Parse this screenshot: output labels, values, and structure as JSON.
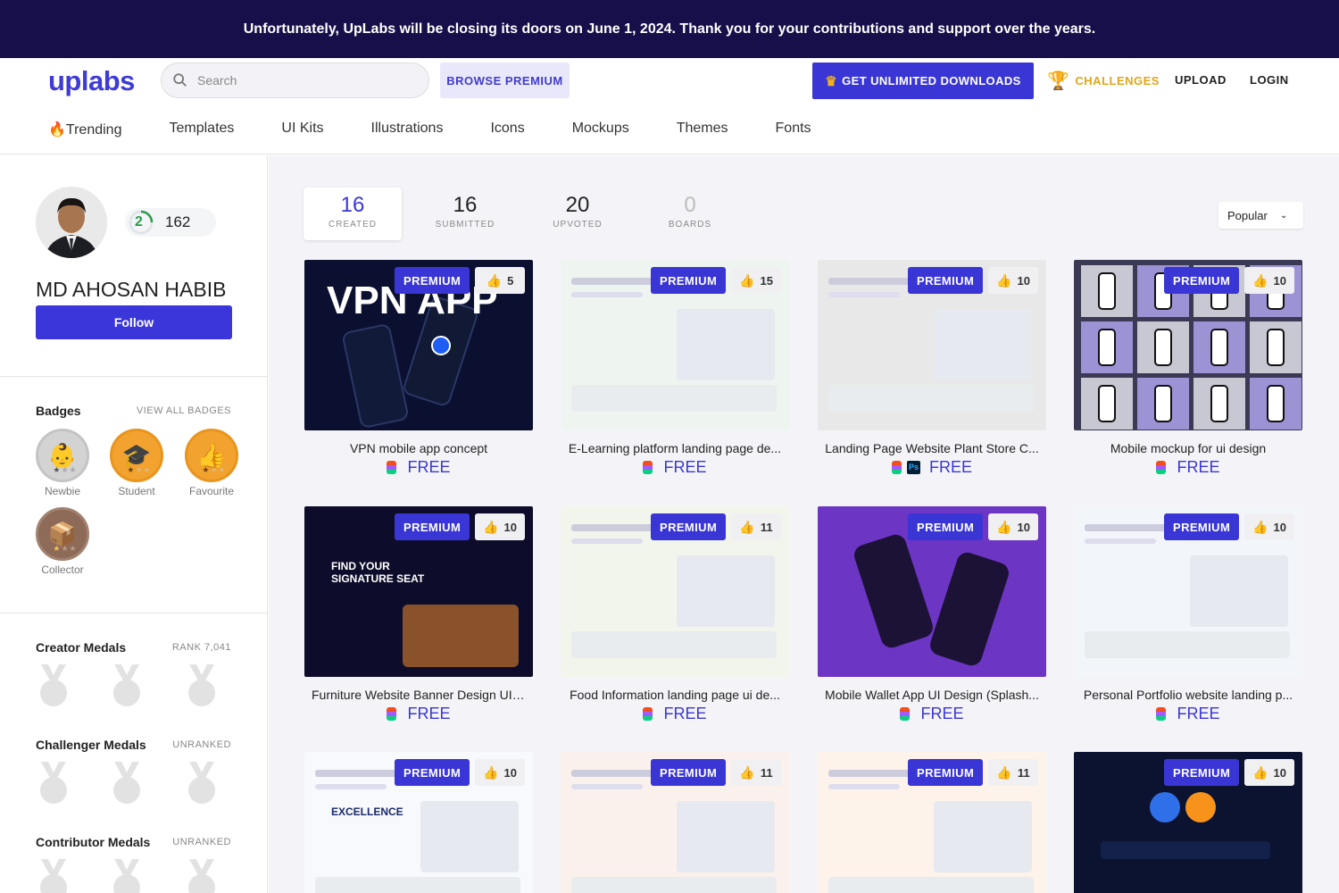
{
  "banner": {
    "text": "Unfortunately, UpLabs will be closing its doors on June 1, 2024. Thank you for your contributions and support over the years."
  },
  "header": {
    "logo": "uplabs",
    "search_placeholder": "Search",
    "browse_premium": "BROWSE PREMIUM",
    "unlimited": "GET UNLIMITED DOWNLOADS",
    "challenges": "CHALLENGES",
    "upload": "UPLOAD",
    "login": "LOGIN"
  },
  "categories": [
    "🔥Trending",
    "Templates",
    "UI Kits",
    "Illustrations",
    "Icons",
    "Mockups",
    "Themes",
    "Fonts"
  ],
  "profile": {
    "level": "2",
    "points": "162",
    "name": "MD AHOSAN HABIB",
    "follow": "Follow",
    "badges_title": "Badges",
    "view_all_badges": "VIEW ALL BADGES",
    "badges": [
      {
        "label": "Newbie",
        "icon": "baby-icon",
        "color": "#d2d2d2"
      },
      {
        "label": "Student",
        "icon": "graduation-cap-icon",
        "color": "#f2a22e"
      },
      {
        "label": "Favourite",
        "icon": "thumbs-up-icon",
        "color": "#f2a22e"
      },
      {
        "label": "Collector",
        "icon": "box-icon",
        "color": "#8e6b58"
      }
    ],
    "creator_medals": {
      "title": "Creator Medals",
      "rank": "RANK 7,041"
    },
    "challenger_medals": {
      "title": "Challenger Medals",
      "rank": "UNRANKED"
    },
    "contributor_medals": {
      "title": "Contributor Medals",
      "rank": "UNRANKED"
    }
  },
  "stats": [
    {
      "value": "16",
      "label": "CREATED"
    },
    {
      "value": "16",
      "label": "SUBMITTED"
    },
    {
      "value": "20",
      "label": "UPVOTED"
    },
    {
      "value": "0",
      "label": "BOARDS"
    }
  ],
  "sort": "Popular",
  "premium_label": "PREMIUM",
  "cards": [
    {
      "title": "VPN mobile app concept",
      "likes": "5",
      "price": "FREE",
      "tools": [
        "figma"
      ],
      "thumb_text": "VPN APP",
      "bg": "#0b1030"
    },
    {
      "title": "E-Learning platform landing page de...",
      "likes": "15",
      "price": "FREE",
      "tools": [
        "figma"
      ],
      "thumb_text": "",
      "bg": "#eef5f0"
    },
    {
      "title": "Landing Page Website Plant Store C...",
      "likes": "10",
      "price": "FREE",
      "tools": [
        "figma",
        "ps"
      ],
      "thumb_text": "",
      "bg": "#e8e8e8"
    },
    {
      "title": "Mobile mockup for ui design",
      "likes": "10",
      "price": "FREE",
      "tools": [
        "figma"
      ],
      "thumb_text": "",
      "bg": "#3a3a55"
    },
    {
      "title": "Furniture Website Banner Design UI ...",
      "likes": "10",
      "price": "FREE",
      "tools": [
        "figma"
      ],
      "thumb_text": "FIND YOUR SIGNATURE SEAT",
      "bg": "#0d0d2b"
    },
    {
      "title": "Food Information landing page ui de...",
      "likes": "11",
      "price": "FREE",
      "tools": [
        "figma"
      ],
      "thumb_text": "",
      "bg": "#f1f5ec"
    },
    {
      "title": "Mobile Wallet App UI Design (Splash...",
      "likes": "10",
      "price": "FREE",
      "tools": [
        "figma"
      ],
      "thumb_text": "",
      "bg": "#6c35c4"
    },
    {
      "title": "Personal Portfolio website landing p...",
      "likes": "10",
      "price": "FREE",
      "tools": [
        "figma"
      ],
      "thumb_text": "",
      "bg": "#f2f6fb"
    },
    {
      "title": "",
      "likes": "10",
      "price": "",
      "tools": [],
      "thumb_text": "EXCELLENCE",
      "bg": "#f7f9fd"
    },
    {
      "title": "",
      "likes": "11",
      "price": "",
      "tools": [],
      "thumb_text": "",
      "bg": "#fbf1ec"
    },
    {
      "title": "",
      "likes": "11",
      "price": "",
      "tools": [],
      "thumb_text": "",
      "bg": "#fdf3ea"
    },
    {
      "title": "",
      "likes": "10",
      "price": "",
      "tools": [],
      "thumb_text": "",
      "bg": "#0b1331"
    }
  ]
}
